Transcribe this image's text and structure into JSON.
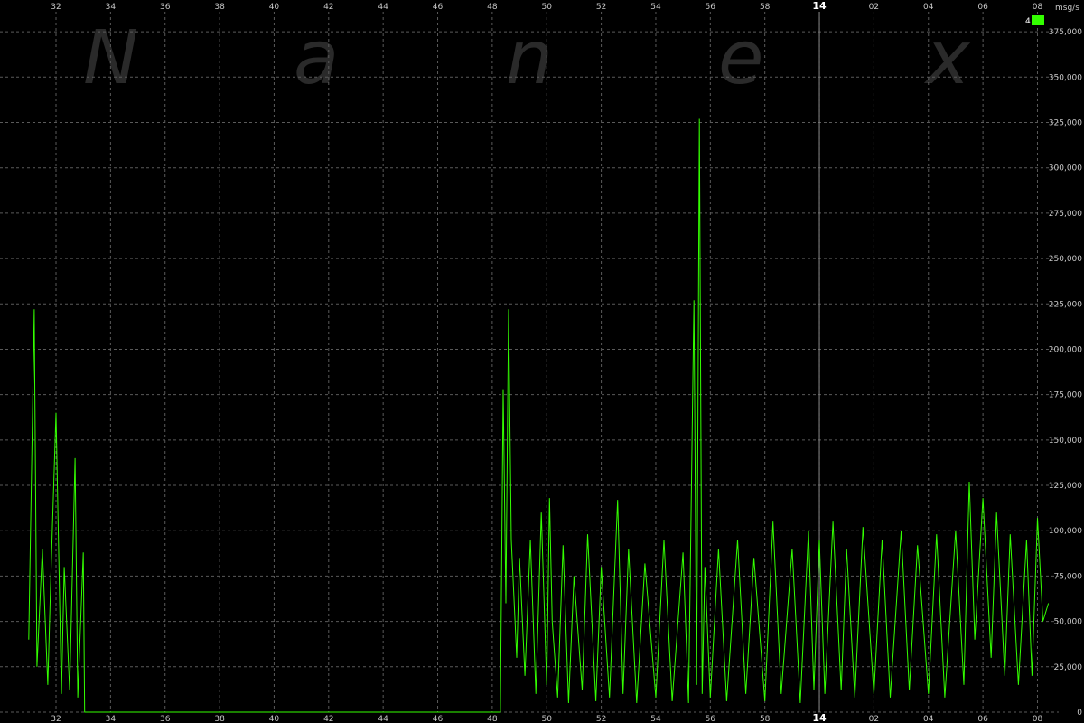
{
  "watermark": [
    "N",
    "a",
    "n",
    "e",
    "x"
  ],
  "chart_data": {
    "type": "line",
    "title": "",
    "xlabel": "",
    "ylabel": "msg/s",
    "ylim": [
      0,
      390000
    ],
    "grid": true,
    "legend": {
      "placement": "top-right",
      "entries": [
        {
          "name": "4",
          "color": "#33ff00"
        }
      ]
    },
    "y_ticks": [
      "0",
      "25,000",
      "50,000",
      "75,000",
      "100,000",
      "125,000",
      "150,000",
      "175,000",
      "200,000",
      "225,000",
      "250,000",
      "275,000",
      "300,000",
      "325,000",
      "350,000",
      "375,000"
    ],
    "x_ticks": [
      "32",
      "34",
      "36",
      "38",
      "40",
      "42",
      "44",
      "46",
      "48",
      "50",
      "52",
      "54",
      "56",
      "58",
      "14",
      "02",
      "04",
      "06",
      "08"
    ],
    "x_ticks_bold": [
      "14"
    ],
    "x_units": "minutes (13:31 - 14:08)",
    "series": [
      {
        "color": "#33ff00",
        "x": [
          31.0,
          31.2,
          31.3,
          31.5,
          31.7,
          31.8,
          32.0,
          32.2,
          32.3,
          32.5,
          32.7,
          32.8,
          33.0,
          33.05,
          48.3,
          48.4,
          48.5,
          48.6,
          48.7,
          48.9,
          49.0,
          49.2,
          49.4,
          49.6,
          49.8,
          50.0,
          50.1,
          50.2,
          50.4,
          50.6,
          50.8,
          51.0,
          51.3,
          51.5,
          51.8,
          52.0,
          52.3,
          52.6,
          52.8,
          53.0,
          53.3,
          53.6,
          54.0,
          54.3,
          54.6,
          55.0,
          55.2,
          55.4,
          55.5,
          55.6,
          55.7,
          55.8,
          56.0,
          56.3,
          56.6,
          57.0,
          57.3,
          57.6,
          58.0,
          58.3,
          58.6,
          59.0,
          59.3,
          59.6,
          59.8,
          60.0,
          60.2,
          60.5,
          60.8,
          61.0,
          61.3,
          61.6,
          62.0,
          62.3,
          62.6,
          63.0,
          63.3,
          63.6,
          64.0,
          64.3,
          64.6,
          65.0,
          65.3,
          65.5,
          65.7,
          66.0,
          66.3,
          66.5,
          66.8,
          67.0,
          67.3,
          67.6,
          67.8,
          68.0,
          68.2,
          68.4
        ],
        "values": [
          40000,
          222000,
          25000,
          90000,
          15000,
          70000,
          165000,
          10000,
          80000,
          12000,
          140000,
          8000,
          88000,
          0,
          0,
          178000,
          60000,
          222000,
          95000,
          30000,
          85000,
          20000,
          95000,
          10000,
          110000,
          15000,
          118000,
          50000,
          8000,
          92000,
          5000,
          75000,
          12000,
          98000,
          6000,
          80000,
          8000,
          117000,
          10000,
          90000,
          5000,
          82000,
          8000,
          95000,
          6000,
          88000,
          5000,
          227000,
          15000,
          327000,
          10000,
          80000,
          8000,
          90000,
          6000,
          95000,
          10000,
          85000,
          6000,
          105000,
          10000,
          90000,
          5000,
          100000,
          12000,
          95000,
          10000,
          105000,
          12000,
          90000,
          8000,
          102000,
          10000,
          95000,
          8000,
          100000,
          12000,
          92000,
          10000,
          98000,
          8000,
          100000,
          15000,
          127000,
          40000,
          118000,
          30000,
          110000,
          20000,
          98000,
          15000,
          95000,
          20000,
          107000,
          50000,
          60000
        ]
      }
    ]
  }
}
